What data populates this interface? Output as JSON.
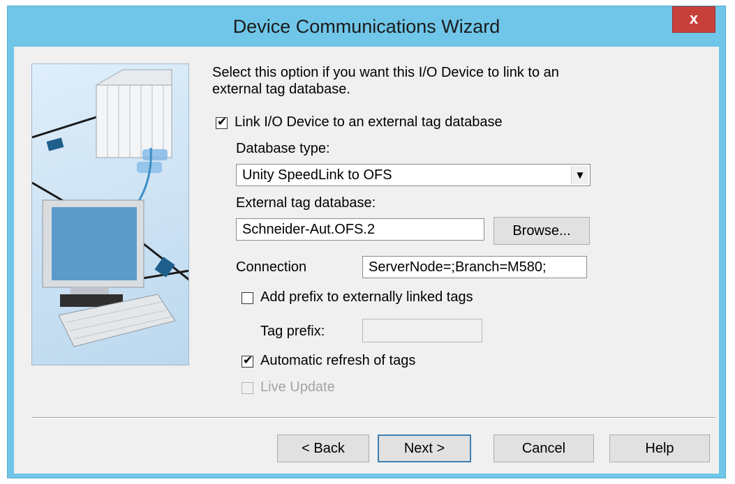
{
  "window": {
    "title": "Device Communications Wizard",
    "close_label": "x"
  },
  "description": [
    "Select this option if you want this I/O Device to link to an",
    "external tag database."
  ],
  "link_checkbox": {
    "label": "Link I/O Device to an external tag database",
    "checked": true
  },
  "database_type": {
    "label": "Database type:",
    "value": "Unity SpeedLink to OFS"
  },
  "external_db": {
    "label": "External tag database:",
    "value": "Schneider-Aut.OFS.2",
    "browse_label": "Browse..."
  },
  "connection": {
    "label": "Connection",
    "value": "ServerNode=;Branch=M580;"
  },
  "prefix_checkbox": {
    "label": "Add prefix to externally linked tags",
    "checked": false
  },
  "tag_prefix": {
    "label": "Tag prefix:",
    "value": ""
  },
  "auto_refresh": {
    "label": "Automatic refresh of tags",
    "checked": true
  },
  "live_update": {
    "label": "Live Update",
    "checked": false,
    "enabled": false
  },
  "buttons": {
    "back": "< Back",
    "next": "Next >",
    "cancel": "Cancel",
    "help": "Help"
  },
  "colors": {
    "frame": "#6fc6e8",
    "close": "#c7403a",
    "dialog": "#f0f0f0"
  }
}
